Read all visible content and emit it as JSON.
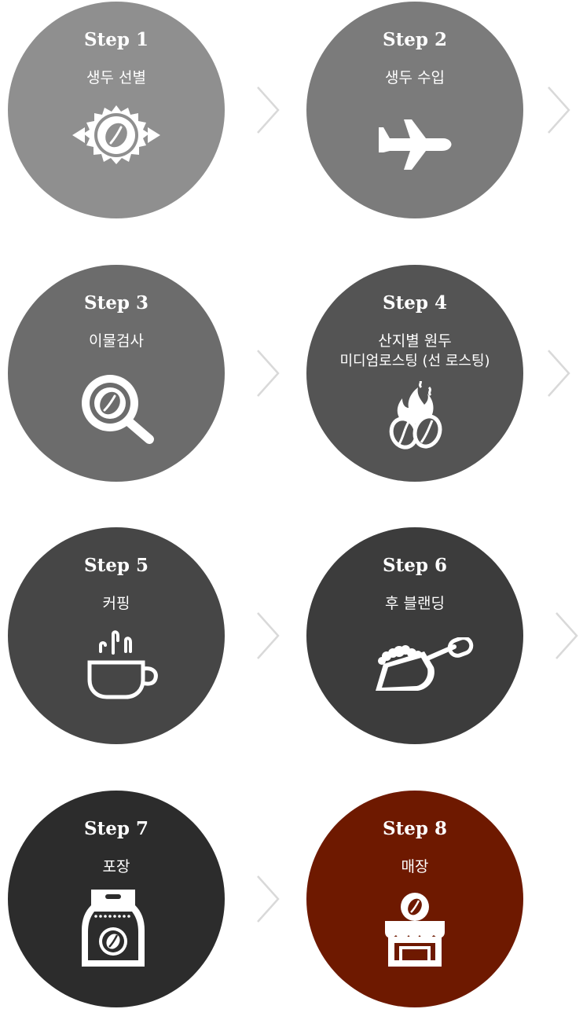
{
  "steps": [
    {
      "label": "Step 1",
      "desc": [
        "생두 선별"
      ],
      "icon": "quality-badge-bean-icon",
      "color": "#8f8f8f"
    },
    {
      "label": "Step 2",
      "desc": [
        "생두 수입"
      ],
      "icon": "airplane-icon",
      "color": "#7b7b7b"
    },
    {
      "label": "Step 3",
      "desc": [
        "이물검사"
      ],
      "icon": "magnifier-bean-icon",
      "color": "#6c6c6c"
    },
    {
      "label": "Step 4",
      "desc": [
        "산지별 원두",
        "미디엄로스팅 (선 로스팅)"
      ],
      "icon": "roasting-beans-fire-icon",
      "color": "#545454"
    },
    {
      "label": "Step 5",
      "desc": [
        "커핑"
      ],
      "icon": "coffee-cup-steam-icon",
      "color": "#464646"
    },
    {
      "label": "Step 6",
      "desc": [
        "후 블랜딩"
      ],
      "icon": "coffee-scoop-icon",
      "color": "#3c3c3c"
    },
    {
      "label": "Step 7",
      "desc": [
        "포장"
      ],
      "icon": "coffee-bag-icon",
      "color": "#2c2c2c"
    },
    {
      "label": "Step 8",
      "desc": [
        "매장"
      ],
      "icon": "coffee-shop-icon",
      "color": "#6e1900"
    }
  ],
  "arrow_color": "#d9d9d9"
}
